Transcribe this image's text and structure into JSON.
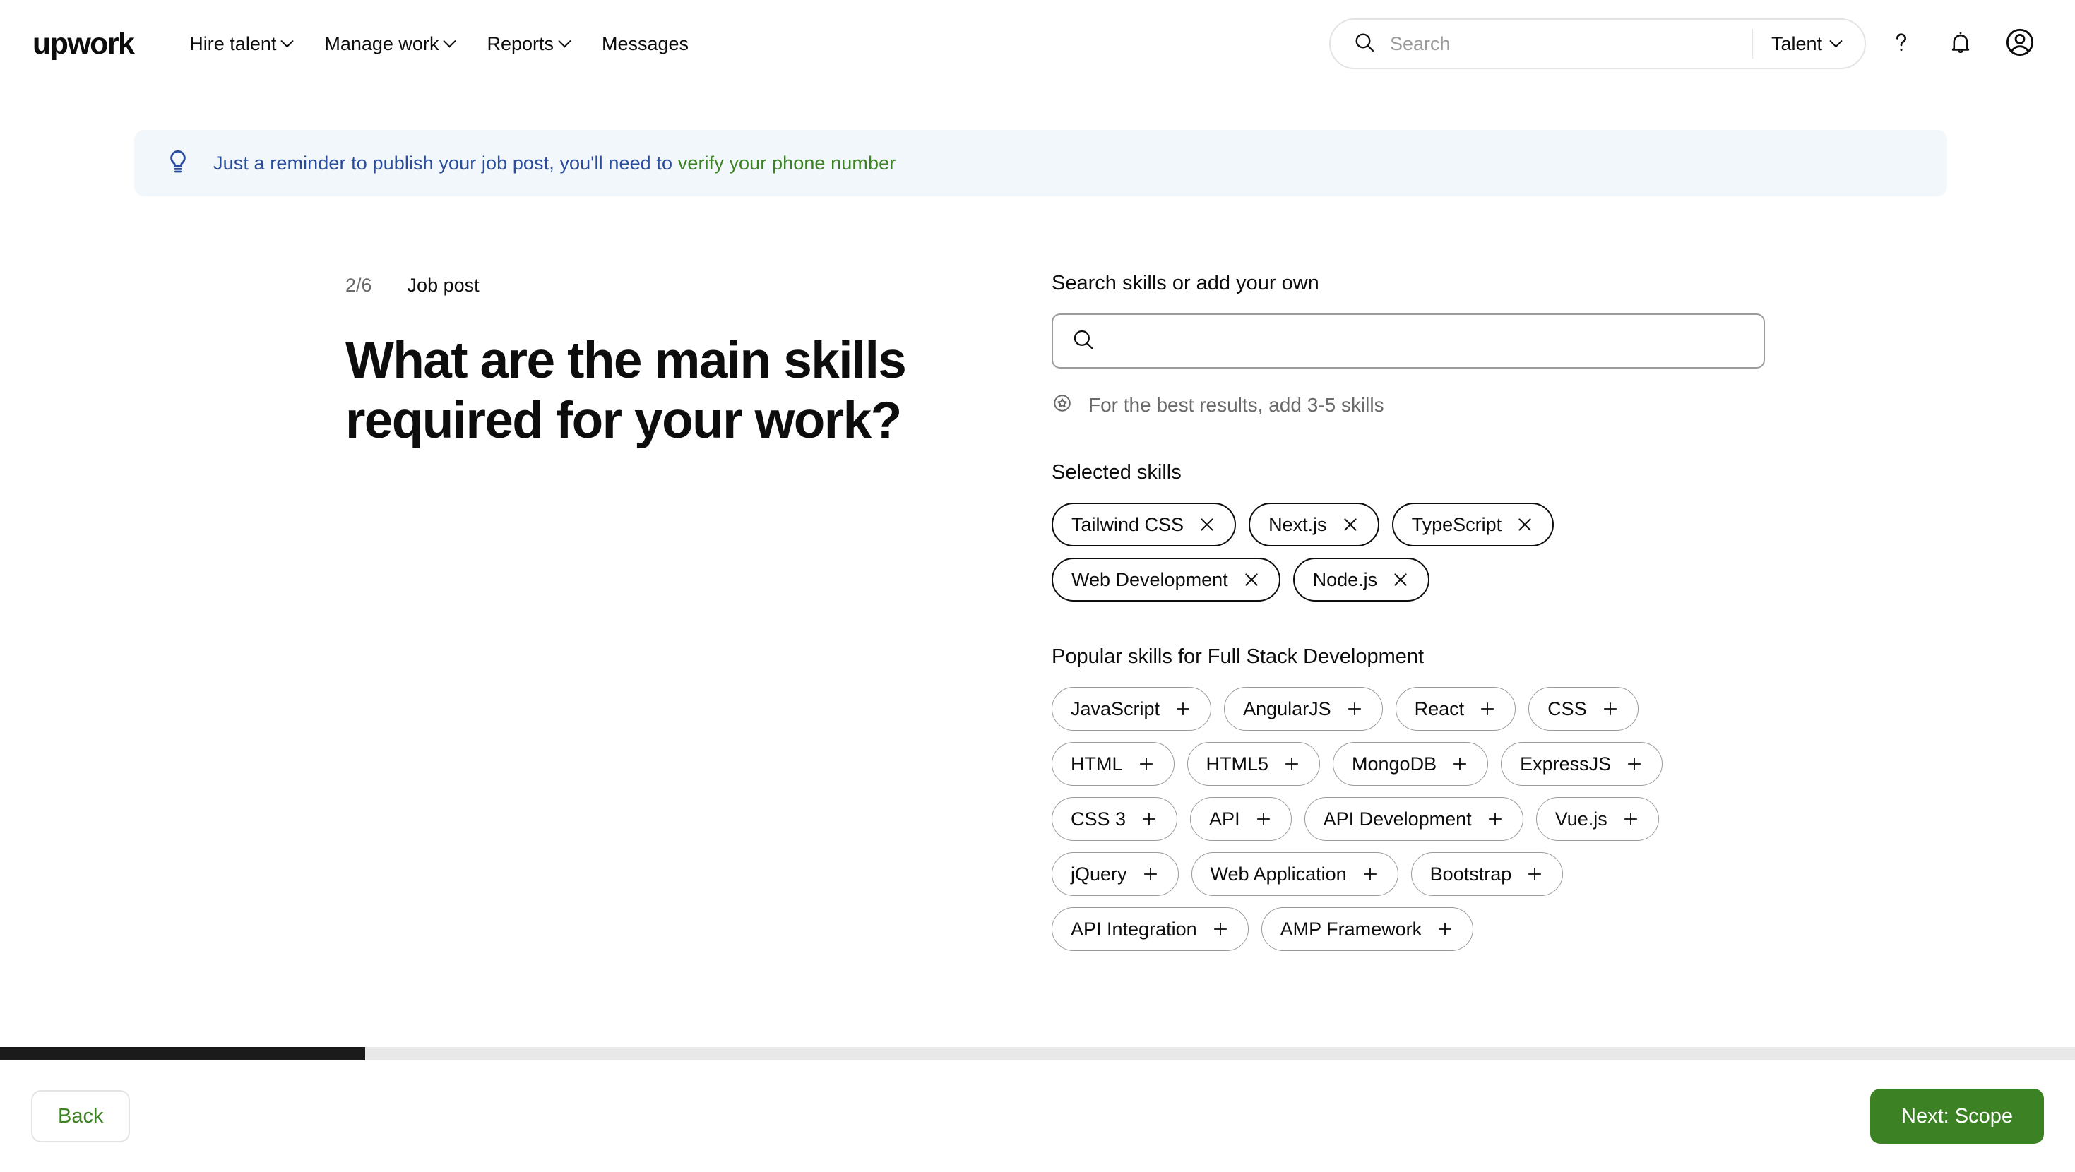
{
  "header": {
    "brand": "upwork",
    "nav": [
      {
        "label": "Hire talent",
        "has_caret": true
      },
      {
        "label": "Manage work",
        "has_caret": true
      },
      {
        "label": "Reports",
        "has_caret": true
      },
      {
        "label": "Messages",
        "has_caret": false
      }
    ],
    "search": {
      "value": "",
      "placeholder": "Search"
    },
    "scope_select": "Talent",
    "icons": [
      "help-icon",
      "notifications-bell-icon",
      "user-avatar-icon"
    ]
  },
  "banner": {
    "icon": "lightbulb-icon",
    "text_before": "Just a reminder to publish your job post, you'll need to ",
    "link_text": "verify your phone number",
    "bg_color": "#f2f7fc",
    "text_color": "#2a4d9b",
    "link_color": "#3c8224"
  },
  "main": {
    "step_number": "2/6",
    "step_label": "Job post",
    "headline": "What are the main skills required for your work?"
  },
  "skills_panel": {
    "search_label": "Search skills or add your own",
    "search_value": "",
    "search_placeholder": "",
    "hint_icon": "star-circle-icon",
    "hint_text": "For the best results, add 3-5 skills",
    "selected_title": "Selected skills",
    "selected_skills": [
      "Tailwind CSS",
      "Next.js",
      "TypeScript",
      "Web Development",
      "Node.js"
    ],
    "popular_title": "Popular skills for Full Stack Development",
    "popular_skills": [
      "JavaScript",
      "AngularJS",
      "React",
      "CSS",
      "HTML",
      "HTML5",
      "MongoDB",
      "ExpressJS",
      "CSS 3",
      "API",
      "API Development",
      "Vue.js",
      "jQuery",
      "Web Application",
      "Bootstrap",
      "API Integration",
      "AMP Framework"
    ]
  },
  "scrollbar": {
    "thumb_percent": 17.6,
    "thumb_color": "#1b1b1b",
    "track_color": "#e8e8e8"
  },
  "footer": {
    "back_label": "Back",
    "next_label": "Next: Scope",
    "next_bg": "#3c8224",
    "back_text_color": "#3c8224"
  }
}
